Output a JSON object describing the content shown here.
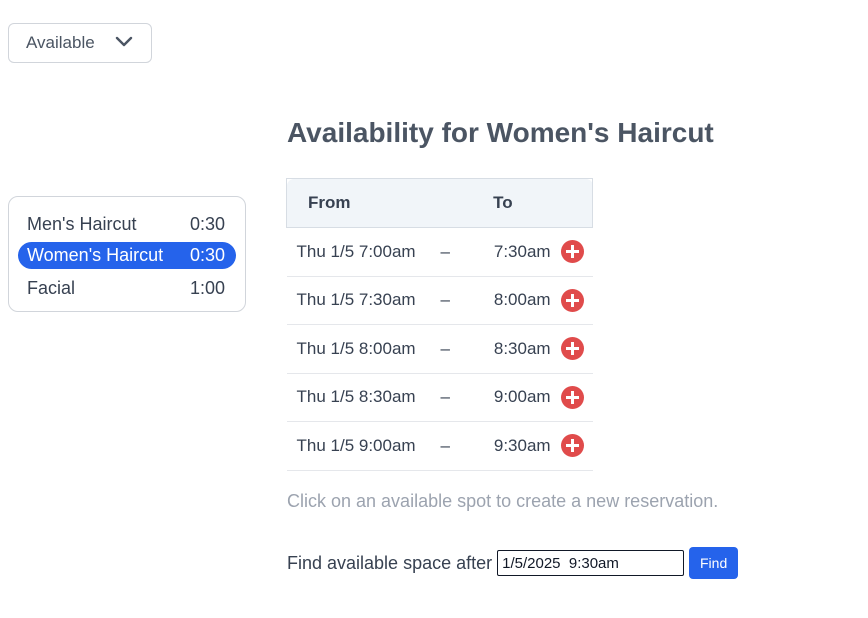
{
  "filter": {
    "value": "Available",
    "icon": "chevron-down-icon"
  },
  "services": [
    {
      "name": "Men's Haircut",
      "duration": "0:30",
      "selected": false
    },
    {
      "name": "Women's Haircut",
      "duration": "0:30",
      "selected": true
    },
    {
      "name": "Facial",
      "duration": "1:00",
      "selected": false
    }
  ],
  "title": "Availability for Women's Haircut",
  "table": {
    "from_header": "From",
    "to_header": "To",
    "separator": "–",
    "add_icon": "add-circle-icon",
    "rows": [
      {
        "from": "Thu 1/5 7:00am",
        "to": "7:30am"
      },
      {
        "from": "Thu 1/5 7:30am",
        "to": "8:00am"
      },
      {
        "from": "Thu 1/5 8:00am",
        "to": "8:30am"
      },
      {
        "from": "Thu 1/5 8:30am",
        "to": "9:00am"
      },
      {
        "from": "Thu 1/5 9:00am",
        "to": "9:30am"
      }
    ]
  },
  "hint": "Click on an available spot to create a new reservation.",
  "find": {
    "label": "Find available space after",
    "value": "1/5/2025  9:30am",
    "button": "Find"
  },
  "colors": {
    "accent": "#2563eb",
    "add": "#e04b4b",
    "muted": "#9ca3af"
  }
}
